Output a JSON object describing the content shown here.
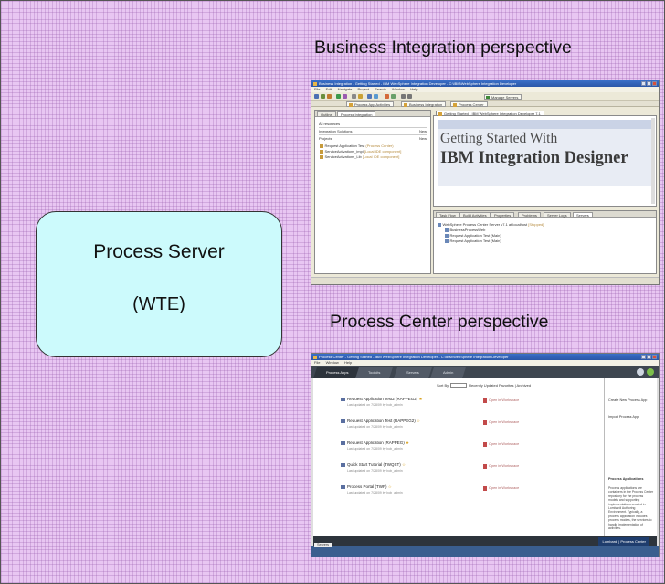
{
  "server": {
    "title": "Process Server",
    "subtitle": "(WTE)"
  },
  "perspectives": {
    "bi_title": "Business Integration perspective",
    "pc_title": "Process Center perspective"
  },
  "bi_window": {
    "title": "Business Integration - Getting Started - IBM WebSphere Integration Developer - C:\\IBM\\WebSphere Integration Developer",
    "menus": [
      "File",
      "Edit",
      "Navigate",
      "Project",
      "Search",
      "Window",
      "Help"
    ],
    "manage_button": "Manage Servers",
    "perspective_tabs": [
      "Process App Activities",
      "Business Integration",
      "Process Center"
    ],
    "left_tabs": [
      "Outline",
      "Process Integration"
    ],
    "filter_label": "All resources",
    "integration_solutions": "Integration Solutions",
    "projects": "Projects",
    "new_label": "New",
    "tree_items": [
      {
        "label": "Request Application Test",
        "annotation": "(Process Center)"
      },
      {
        "label": "ServiceActivations_impl",
        "annotation": "[Local IDE component]"
      },
      {
        "label": "ServiceActivations_Lib",
        "annotation": "[Local IDE component]"
      }
    ],
    "editor_tab": "Getting Started - IBM WebSphere Integration Developer 7.1",
    "welcome_line1": "Getting Started With",
    "welcome_line2": "IBM Integration Designer",
    "lower_tabs": [
      "Task Flow",
      "Build Activities",
      "Properties",
      "Problems",
      "Server Logs",
      "Servers"
    ],
    "lower_tree": [
      {
        "label": "WebSphere Process Center Server v7.1 at localhost",
        "annotation": "[Stopped]"
      },
      {
        "label": "BusinessProcessWeb",
        "annotation": ""
      },
      {
        "label": "Request Application Test (Main)",
        "annotation": ""
      },
      {
        "label": "Request Application Test (Main)",
        "annotation": ""
      }
    ]
  },
  "pc_window": {
    "title": "Process Center - Getting Started - IBM WebSphere Integration Developer - C:\\IBM\\WebSphere Integration Developer",
    "menus": [
      "File",
      "Window",
      "Help"
    ],
    "nav_tabs": [
      "Process Apps",
      "Toolkits",
      "Servers",
      "Admin"
    ],
    "sort_label": "Sort By",
    "sort_value": "Recently Updated",
    "sort_links": "Favorites | Archived",
    "apps": [
      {
        "name": "Request Application Test2 (RAPPEG2)",
        "meta": "Last updated on 7/28/09 by bob_admin",
        "open": "Open in Workspace",
        "star": "★"
      },
      {
        "name": "Request Application Test (RAPPEG2)",
        "meta": "Last updated on 7/28/09 by bob_admin",
        "open": "Open in Workspace",
        "star": "☆"
      },
      {
        "name": "Request Application (RAPPEG)",
        "meta": "Last updated on 7/28/09 by bob_admin",
        "open": "Open in Workspace",
        "star": "★"
      },
      {
        "name": "Quick Start Tutorial (TWQST)",
        "meta": "Last updated on 7/28/09 by bob_admin",
        "open": "Open in Workspace",
        "star": "☆"
      },
      {
        "name": "Process Portal (TWP)",
        "meta": "Last updated on 7/28/09 by bob_admin",
        "open": "Open in Workspace",
        "star": "☆"
      }
    ],
    "side_links": [
      "Create New Process App",
      "Import Process App"
    ],
    "side_heading": "Process Applications",
    "side_text": "Process applications are containers in the Process Center repository for the process models and supporting implementations created in Lombardi Authoring Environment. Typically, a process application includes process models, the services to handle implementation of activities.",
    "footer_button": "Lombardi | Process Center",
    "status_tab": "Servers"
  }
}
